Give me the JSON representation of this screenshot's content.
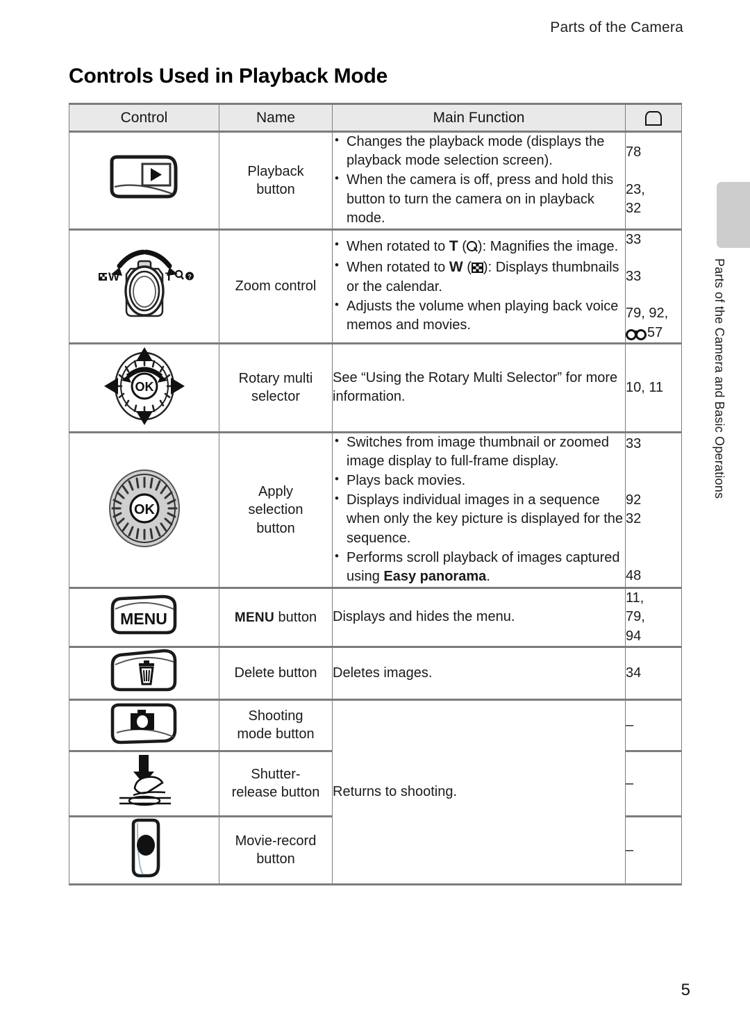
{
  "header": {
    "running_head": "Parts of the Camera",
    "title": "Controls Used in Playback Mode",
    "page_number": "5"
  },
  "side_tab": {
    "label": "Parts of the Camera and Basic Operations"
  },
  "table": {
    "columns": {
      "control": "Control",
      "name": "Name",
      "function": "Main Function",
      "reference_icon": "open-book-icon"
    },
    "rows": [
      {
        "icon": "playback-button-icon",
        "name": "Playback\nbutton",
        "name_line1": "Playback",
        "name_line2": "button",
        "bullets": [
          "Changes the playback mode (displays the playback mode selection screen).",
          "When the camera is off, press and hold this button to turn the camera on in playback mode."
        ],
        "refs": [
          "78",
          "23,",
          "32"
        ]
      },
      {
        "icon": "zoom-control-icon",
        "name": "Zoom control",
        "bullets_rich": [
          "When rotated to T (magnify): Magnifies the image.",
          "When rotated to W (thumbnails): Displays thumbnails or the calendar.",
          "Adjusts the volume when playing back voice memos and movies."
        ],
        "refs": [
          "33",
          "33",
          "79, 92,",
          "57"
        ]
      },
      {
        "icon": "rotary-multi-selector-icon",
        "name_line1": "Rotary multi",
        "name_line2": "selector",
        "function": "See “Using the Rotary Multi Selector” for more information.",
        "refs": [
          "10, 11"
        ]
      },
      {
        "icon": "apply-selection-button-icon",
        "name_line1": "Apply",
        "name_line2": "selection",
        "name_line3": "button",
        "bullets": [
          "Switches from image thumbnail or zoomed image display to full-frame display.",
          "Plays back movies.",
          "Displays individual images in a sequence when only the key picture is displayed for the sequence.",
          "Performs scroll playback of images captured using Easy panorama."
        ],
        "bullet4_prefix": "Performs scroll playback of images captured using ",
        "bullet4_bold": "Easy panorama",
        "bullet4_suffix": ".",
        "refs": [
          "33",
          "92",
          "32",
          "48"
        ]
      },
      {
        "icon": "menu-button-icon",
        "name_prefix": "MENU",
        "name_suffix": " button",
        "function": "Displays and hides the menu.",
        "refs": [
          "11,",
          "79,",
          "94"
        ]
      },
      {
        "icon": "delete-button-icon",
        "name": "Delete button",
        "function": "Deletes images.",
        "refs": [
          "34"
        ]
      },
      {
        "icon": "shooting-mode-button-icon",
        "name_line1": "Shooting",
        "name_line2": "mode button",
        "refs": [
          "–"
        ]
      },
      {
        "icon": "shutter-release-button-icon",
        "name_line1": "Shutter-",
        "name_line2": "release button",
        "function_merged": "Returns to shooting.",
        "refs": [
          "–"
        ]
      },
      {
        "icon": "movie-record-button-icon",
        "name_line1": "Movie-record",
        "name_line2": "button",
        "refs": [
          "–"
        ]
      }
    ]
  },
  "colors": {
    "header_fill": "#e9e9e9",
    "border": "#7c7c7c",
    "tab_gray": "#cdcdcd",
    "dial_gray": "#cccccc"
  }
}
